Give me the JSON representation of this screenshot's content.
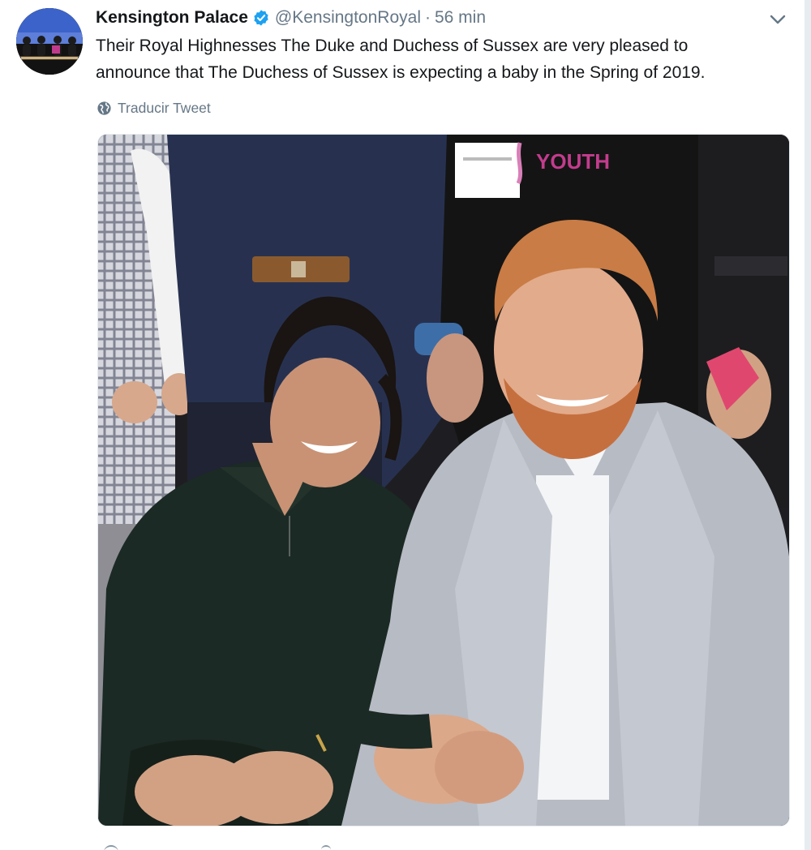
{
  "tweet": {
    "author_name": "Kensington Palace",
    "verified_icon": "verified-badge-icon",
    "handle": "@KensingtonRoyal",
    "separator": "·",
    "time": "56 min",
    "text": "Their Royal Highnesses The Duke and Duchess of Sussex are very pleased to\nannounce that The Duchess of Sussex is expecting a baby in the Spring of 2019.",
    "translate_label": "Traducir Tweet",
    "globe_icon": "globe-icon",
    "menu_icon": "chevron-down-icon"
  },
  "colors": {
    "text": "#14171a",
    "secondary": "#657786",
    "verified": "#1da1f2",
    "border": "#e6ecf0"
  }
}
